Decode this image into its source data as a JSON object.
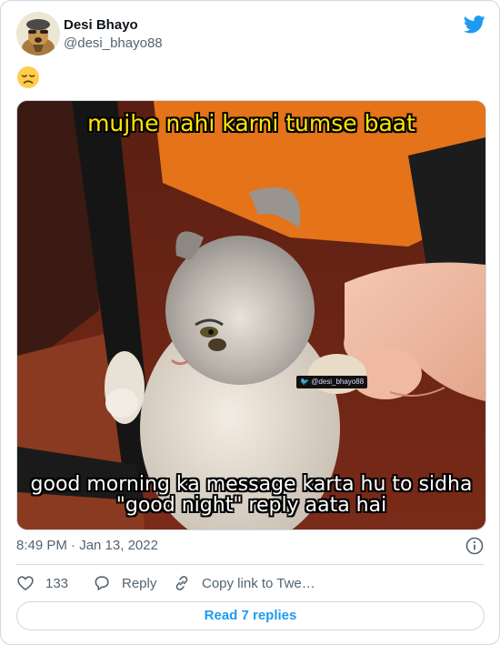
{
  "author": {
    "name": "Desi Bhayo",
    "handle": "@desi_bhayo88"
  },
  "tweet": {
    "emoji": "😞",
    "meme_top_text": "mujhe nahi karni tumse baat",
    "meme_bottom_line1": "good morning ka message karta hu to sidha",
    "meme_bottom_line2": "\"good night\" reply aata hai",
    "watermark": "@desi_bhayo88",
    "timestamp": "8:49 PM · Jan 13, 2022"
  },
  "actions": {
    "like_count": "133",
    "reply_label": "Reply",
    "copy_label": "Copy link to Twe…"
  },
  "footer": {
    "read_replies": "Read 7 replies"
  },
  "icons": {
    "platform": "twitter-bird-icon",
    "info": "info-icon",
    "like": "heart-icon",
    "reply": "reply-bubble-icon",
    "copy": "link-icon"
  },
  "colors": {
    "accent": "#1d9bf0",
    "meme_top": "#ffe600",
    "meme_bottom": "#ffffff",
    "secondary_text": "#536471",
    "border": "#cfd9de"
  }
}
